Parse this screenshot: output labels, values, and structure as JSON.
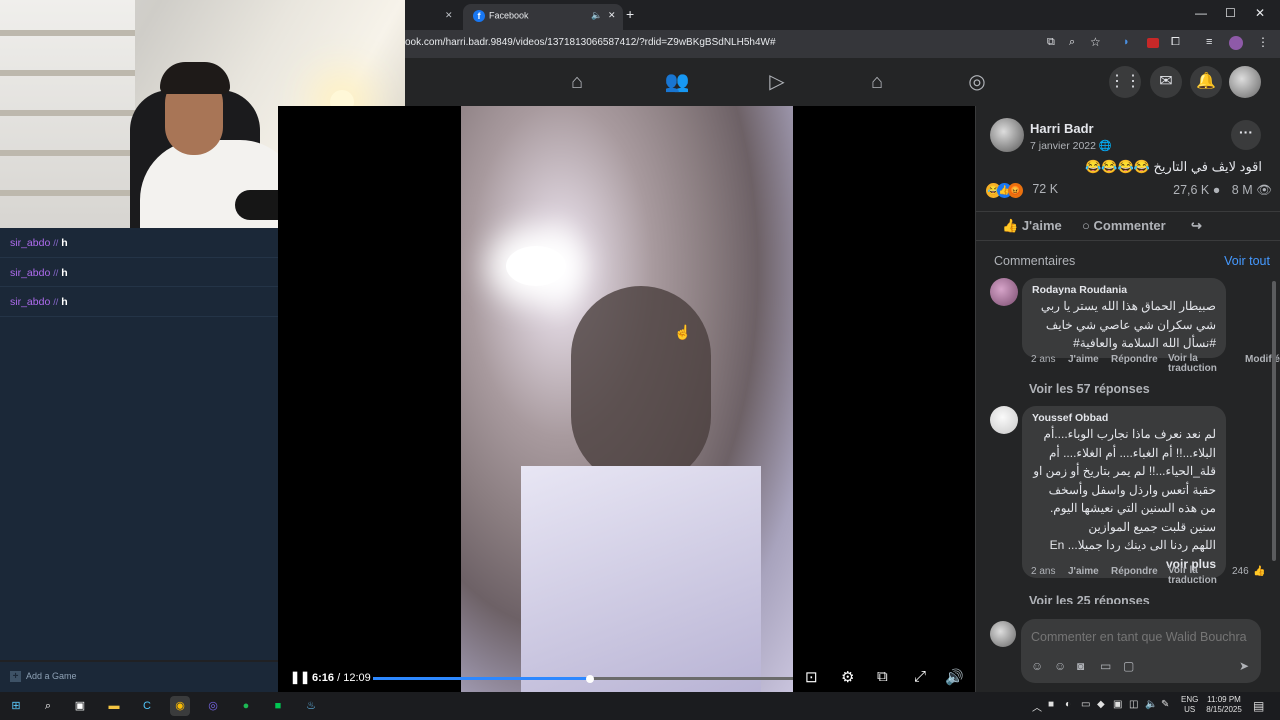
{
  "chat": {
    "messages": [
      {
        "user": "sir_abdo",
        "badge": "//",
        "text": "h"
      },
      {
        "user": "sir_abdo",
        "badge": "//",
        "text": "h"
      },
      {
        "user": "sir_abdo",
        "badge": "//",
        "text": "h"
      }
    ],
    "add_game_label": "Add a Game"
  },
  "browser": {
    "tab_active_title": "Facebook",
    "url": "ook.com/harri.badr.9849/videos/1371813066587412/?rdid=Z9wBKgBSdNLH5h4W#"
  },
  "player": {
    "current_time": "6:16",
    "separator": " / ",
    "duration": "12:09",
    "progress_fraction": 0.516
  },
  "post": {
    "author": "Harri Badr",
    "date": "7 janvier 2022",
    "caption": "اقود لايڤ في التاريخ 😂😂😂😂",
    "reaction_count": "72 K",
    "comment_count": "27,6 K",
    "view_count": "8 M",
    "like_label": "J'aime",
    "comment_label": "Commenter",
    "comments_header": "Commentaires",
    "see_all": "Voir tout"
  },
  "comments": [
    {
      "name": "Rodayna Roudania",
      "lines": [
        "صبيطار الحماق هذا الله يستر يا ربي",
        "شي سكران شي عاصي شي خايف",
        "#نسأل الله السلامة والعافية#"
      ],
      "age": "2 ans",
      "like": "J'aime",
      "reply": "Répondre",
      "translate": "Voir la traduction",
      "modified": "Modifié",
      "replies": "Voir les 57 réponses"
    },
    {
      "name": "Youssef Obbad",
      "lines": [
        "لم نعد نعرف ماذا نجارب الوباء....أم",
        "البلاء...!! أم الغباء.... أم الغلاء.... أم",
        "قلة_الحياء...!! لم يمر بتاريخ أو زمن او",
        "حقبة أتعس وارذل واسفل وأسخف",
        "من هذه السنين التي نعيشها اليوم.",
        "سنين قلبت جميع الموازين",
        "اللهم ردنا الى دينك ردا جميلا... En"
      ],
      "see_more": "voir plus",
      "age": "2 ans",
      "like": "J'aime",
      "reply": "Répondre",
      "translate": "Voir la traduction",
      "like_count": "246",
      "replies": "Voir les 25 réponses"
    }
  ],
  "compose": {
    "placeholder": "Commenter en tant que Walid Bouchra"
  },
  "taskbar": {
    "lang_line1": "ENG",
    "lang_line2": "US",
    "time": "11:09 PM",
    "date": "8/15/2025"
  }
}
